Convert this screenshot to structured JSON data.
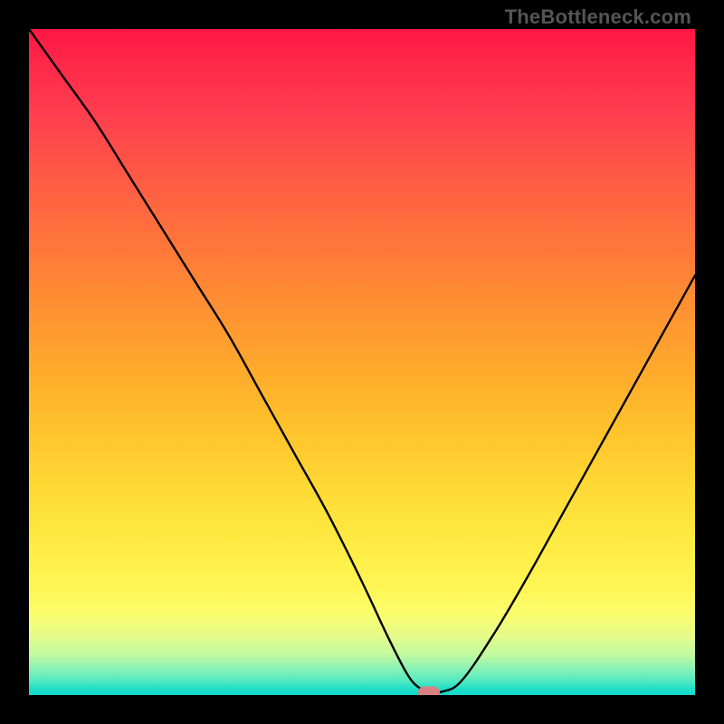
{
  "watermark": "TheBottleneck.com",
  "colors": {
    "frame": "#000000",
    "curve": "#000000",
    "marker": "#d88080"
  },
  "chart_data": {
    "type": "line",
    "title": "",
    "xlabel": "",
    "ylabel": "",
    "xlim": [
      0,
      100
    ],
    "ylim": [
      0,
      100
    ],
    "grid": false,
    "legend": false,
    "background": "red-yellow-green vertical gradient",
    "marker": {
      "x": 60,
      "y": 0.4,
      "shape": "rounded-bar"
    },
    "series": [
      {
        "name": "bottleneck-curve",
        "x": [
          0,
          5,
          10,
          15,
          20,
          25,
          30,
          35,
          40,
          45,
          50,
          54,
          57,
          59,
          60,
          62,
          65,
          70,
          75,
          80,
          85,
          90,
          95,
          100
        ],
        "y": [
          100,
          93,
          86,
          78,
          70,
          62,
          54,
          45,
          36,
          27,
          17,
          8.5,
          2.8,
          0.8,
          0.5,
          0.5,
          2.2,
          9.5,
          18,
          27,
          36,
          45,
          54,
          63
        ]
      }
    ]
  }
}
